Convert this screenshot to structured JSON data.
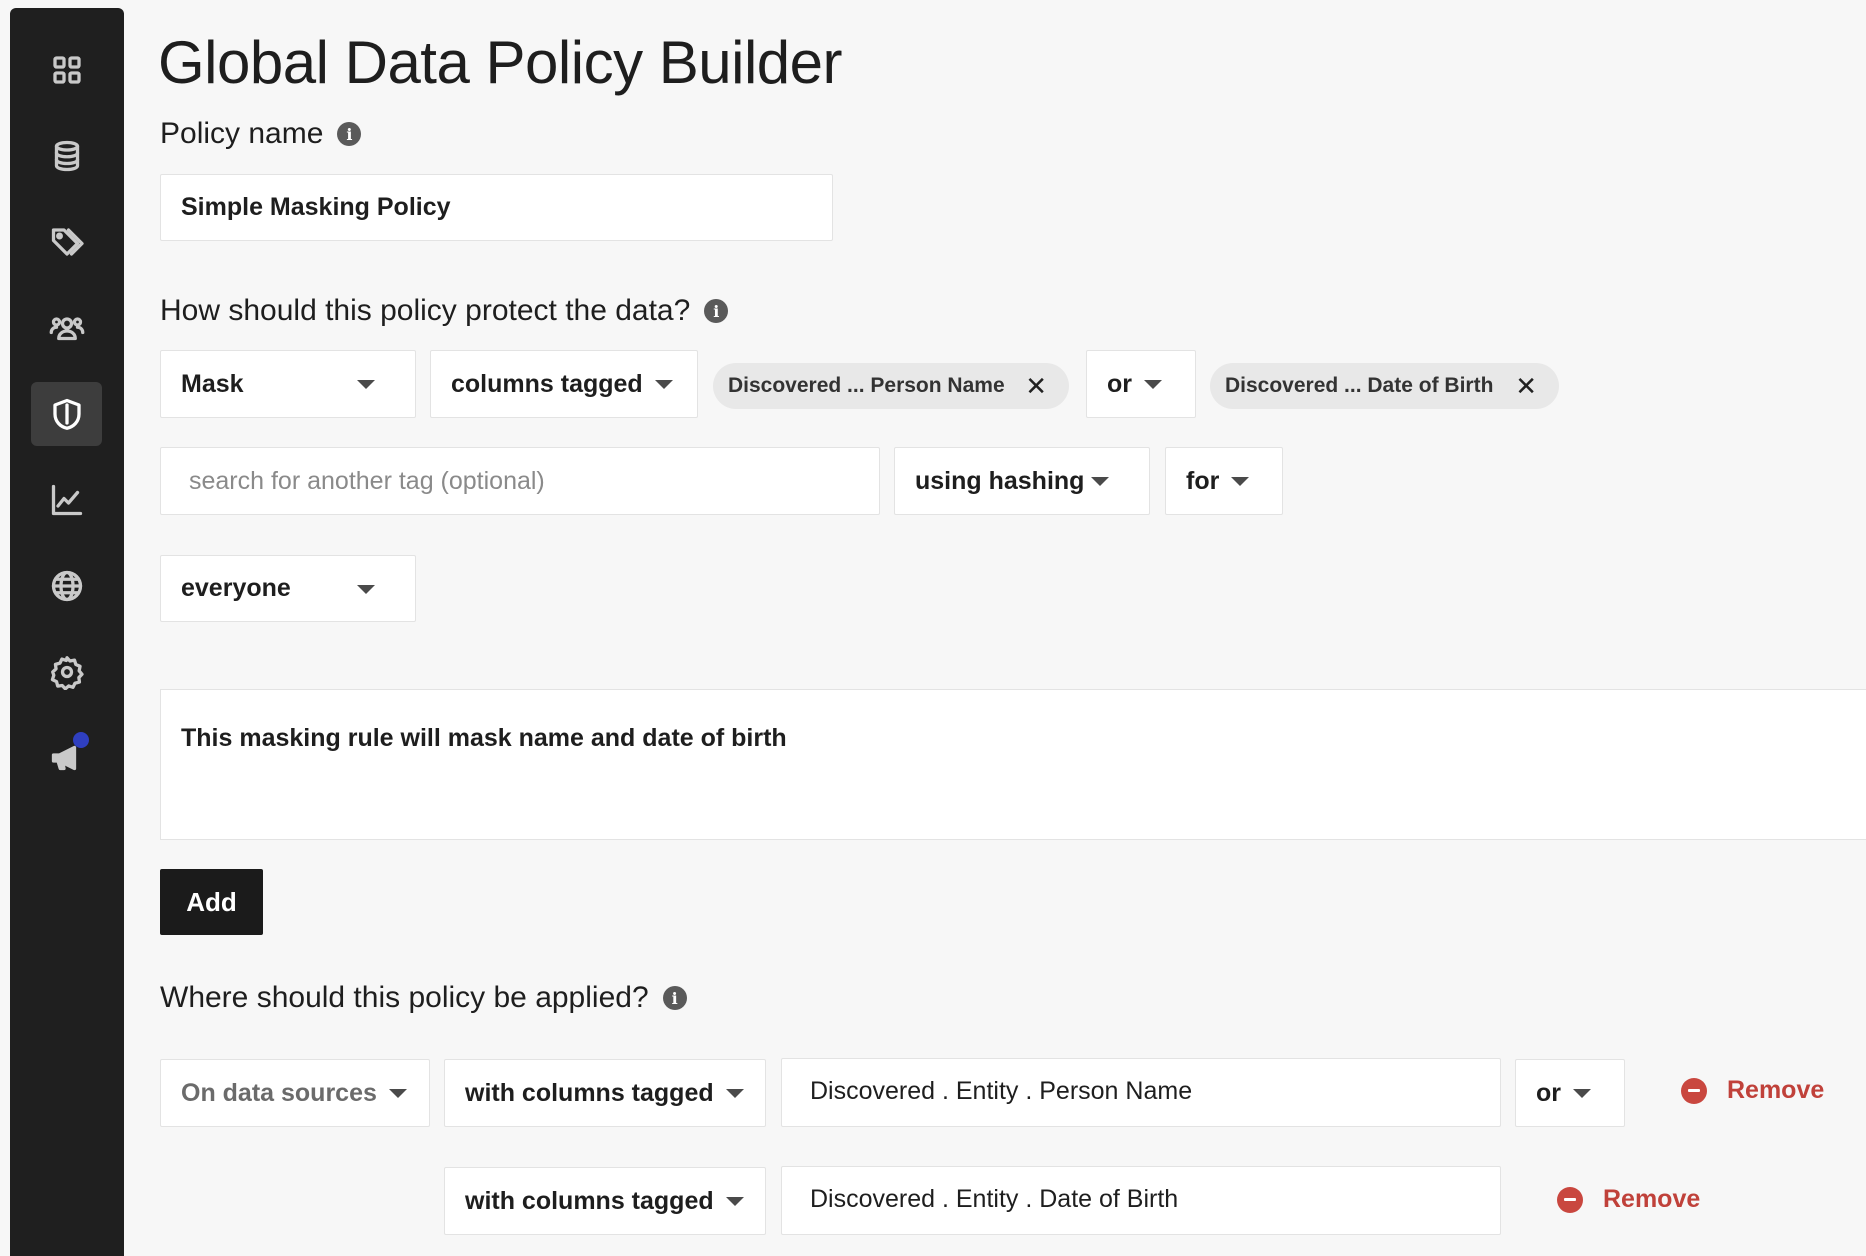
{
  "page": {
    "title": "Global Data Policy Builder"
  },
  "sidebar": {
    "items": [
      {
        "icon": "dashboard-icon",
        "active": false
      },
      {
        "icon": "database-icon",
        "active": false
      },
      {
        "icon": "tags-icon",
        "active": false
      },
      {
        "icon": "users-icon",
        "active": false
      },
      {
        "icon": "shield-icon",
        "active": true
      },
      {
        "icon": "chart-icon",
        "active": false
      },
      {
        "icon": "globe-icon",
        "active": false
      },
      {
        "icon": "gear-icon",
        "active": false
      },
      {
        "icon": "megaphone-icon",
        "active": false,
        "has_notification": true
      }
    ],
    "colors": {
      "background": "#1f1f1f",
      "active": "#3d3d3d",
      "notification": "#2f3fbf"
    }
  },
  "policy_name": {
    "label": "Policy name",
    "value": "Simple Masking Policy"
  },
  "protect": {
    "label": "How should this policy protect the data?",
    "action": "Mask",
    "target": "columns tagged",
    "tags": [
      "Discovered ... Person Name",
      "Discovered ... Date of Birth"
    ],
    "conjunction": "or",
    "tag_search_placeholder": "search for another tag (optional)",
    "method": "using hashing",
    "for_label": "for",
    "audience": "everyone",
    "description": "This masking rule will mask name and date of birth",
    "add_label": "Add"
  },
  "apply": {
    "label": "Where should this policy be applied?",
    "scope": "On data sources",
    "rows": [
      {
        "condition": "with columns tagged",
        "value": "Discovered . Entity . Person Name",
        "conjunction": "or",
        "remove_label": "Remove"
      },
      {
        "condition": "with columns tagged",
        "value": "Discovered . Entity . Date of Birth",
        "remove_label": "Remove"
      }
    ]
  },
  "colors": {
    "accent_dark": "#1b1b1b",
    "remove": "#c0413a",
    "chip": "#e8e8e8"
  }
}
